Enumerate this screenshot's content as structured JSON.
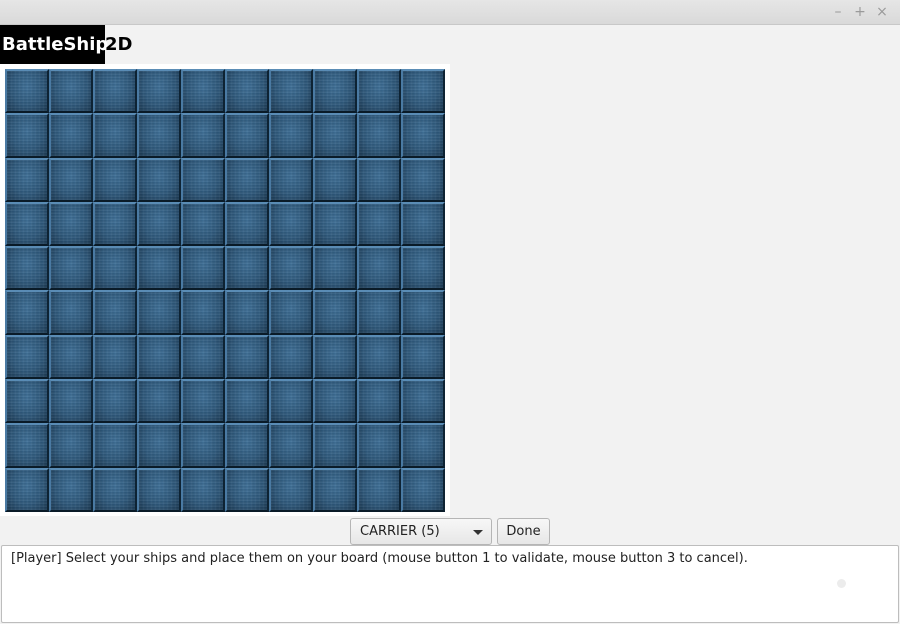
{
  "window": {
    "controls": {
      "minimize": "–",
      "maximize": "+",
      "close": "×"
    }
  },
  "header": {
    "title_part1": "BattleShip",
    "title_part2": "2D"
  },
  "board": {
    "rows": 10,
    "columns": 10,
    "tile": "water-tile"
  },
  "controls": {
    "ship_select_value": "CARRIER (5)",
    "done_label": "Done"
  },
  "log": {
    "message": "[Player] Select your ships and place them on your board (mouse button 1 to validate, mouse button 3 to cancel)."
  }
}
